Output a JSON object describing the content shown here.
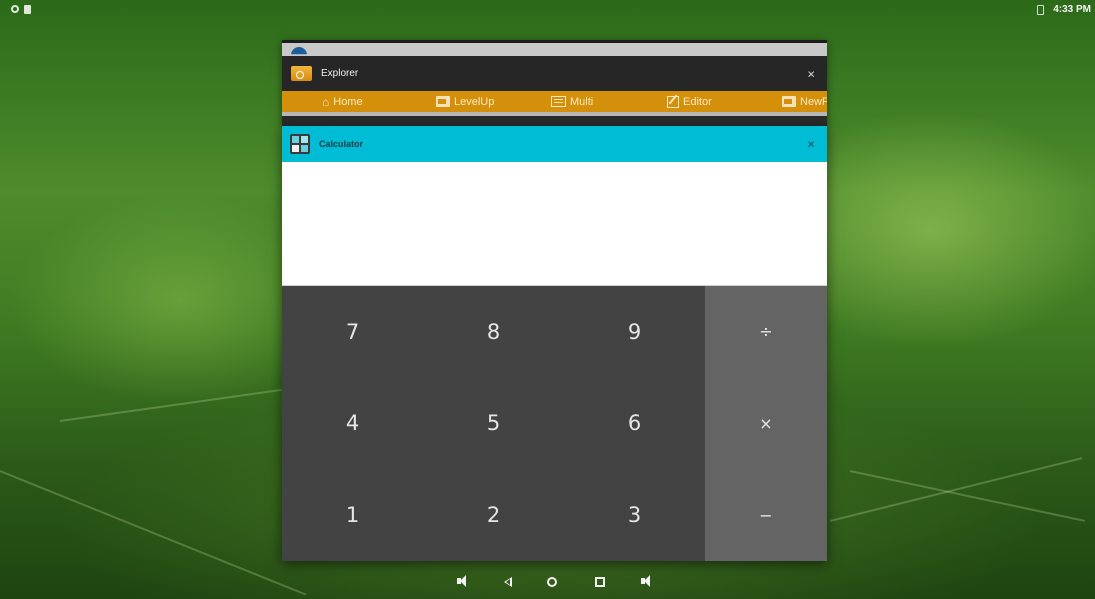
{
  "status_bar": {
    "left_icons": [
      "circle-icon",
      "file-icon"
    ],
    "battery_icon": "battery-icon",
    "clock": "4:33 PM"
  },
  "explorer_window": {
    "title": "Explorer",
    "close_label": "×",
    "toolbar": [
      {
        "label": "Home",
        "icon": "home-icon"
      },
      {
        "label": "LevelUp",
        "icon": "folder-up-icon"
      },
      {
        "label": "Multi",
        "icon": "multi-select-icon"
      },
      {
        "label": "Editor",
        "icon": "edit-icon"
      },
      {
        "label": "NewF",
        "icon": "new-folder-icon"
      }
    ],
    "colors": {
      "titlebar": "#262626",
      "toolbar": "#d4900a"
    }
  },
  "calculator_window": {
    "title": "Calculator",
    "close_label": "×",
    "display": "",
    "digit_keys": [
      "7",
      "8",
      "9",
      "4",
      "5",
      "6",
      "1",
      "2",
      "3"
    ],
    "operator_keys": [
      "÷",
      "×",
      "−"
    ],
    "colors": {
      "titlebar": "#00bcd4",
      "digits_bg": "#434343",
      "ops_bg": "#646464"
    }
  },
  "nav_bar": {
    "buttons": [
      "volume-down-icon",
      "back-icon",
      "home-icon",
      "recents-icon",
      "volume-up-icon"
    ]
  }
}
